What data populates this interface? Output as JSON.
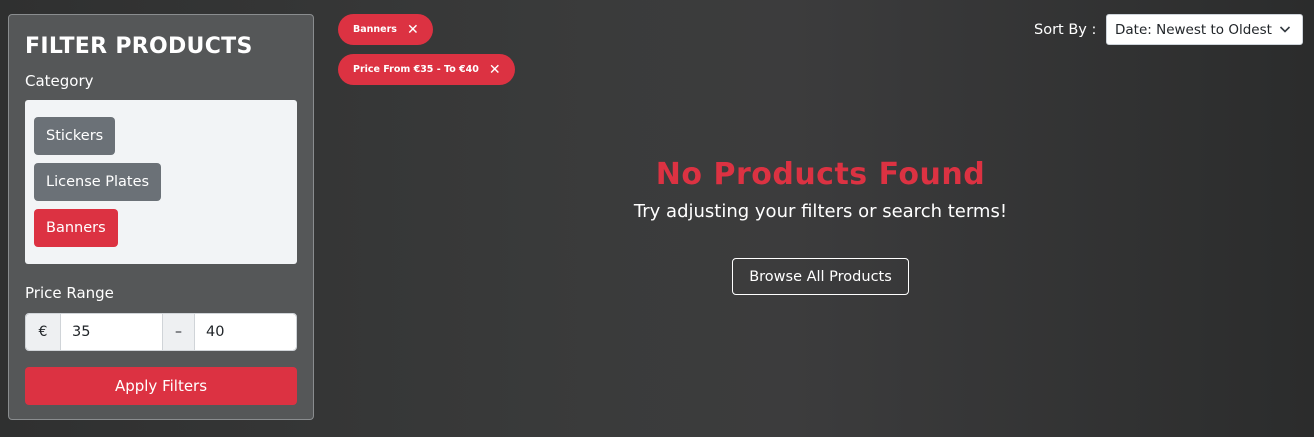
{
  "sidebar": {
    "title": "FILTER PRODUCTS",
    "category_label": "Category",
    "categories": [
      {
        "label": "Stickers",
        "active": false
      },
      {
        "label": "License Plates",
        "active": false
      },
      {
        "label": "Banners",
        "active": true
      }
    ],
    "price_label": "Price Range",
    "currency_symbol": "€",
    "price_min": "35",
    "price_separator": "–",
    "price_max": "40",
    "apply_label": "Apply Filters"
  },
  "active_filters": [
    {
      "label": "Banners",
      "remove_icon": "close-icon"
    },
    {
      "label": "Price From €35 - To €40",
      "remove_icon": "close-icon"
    }
  ],
  "sort": {
    "label": "Sort By :",
    "selected": "Date: Newest to Oldest"
  },
  "empty_state": {
    "title": "No Products Found",
    "subtitle": "Try adjusting your filters or search terms!",
    "button_label": "Browse All Products"
  },
  "colors": {
    "accent": "#dc3242",
    "inactive_chip": "#6b7177",
    "panel": "#555758"
  }
}
